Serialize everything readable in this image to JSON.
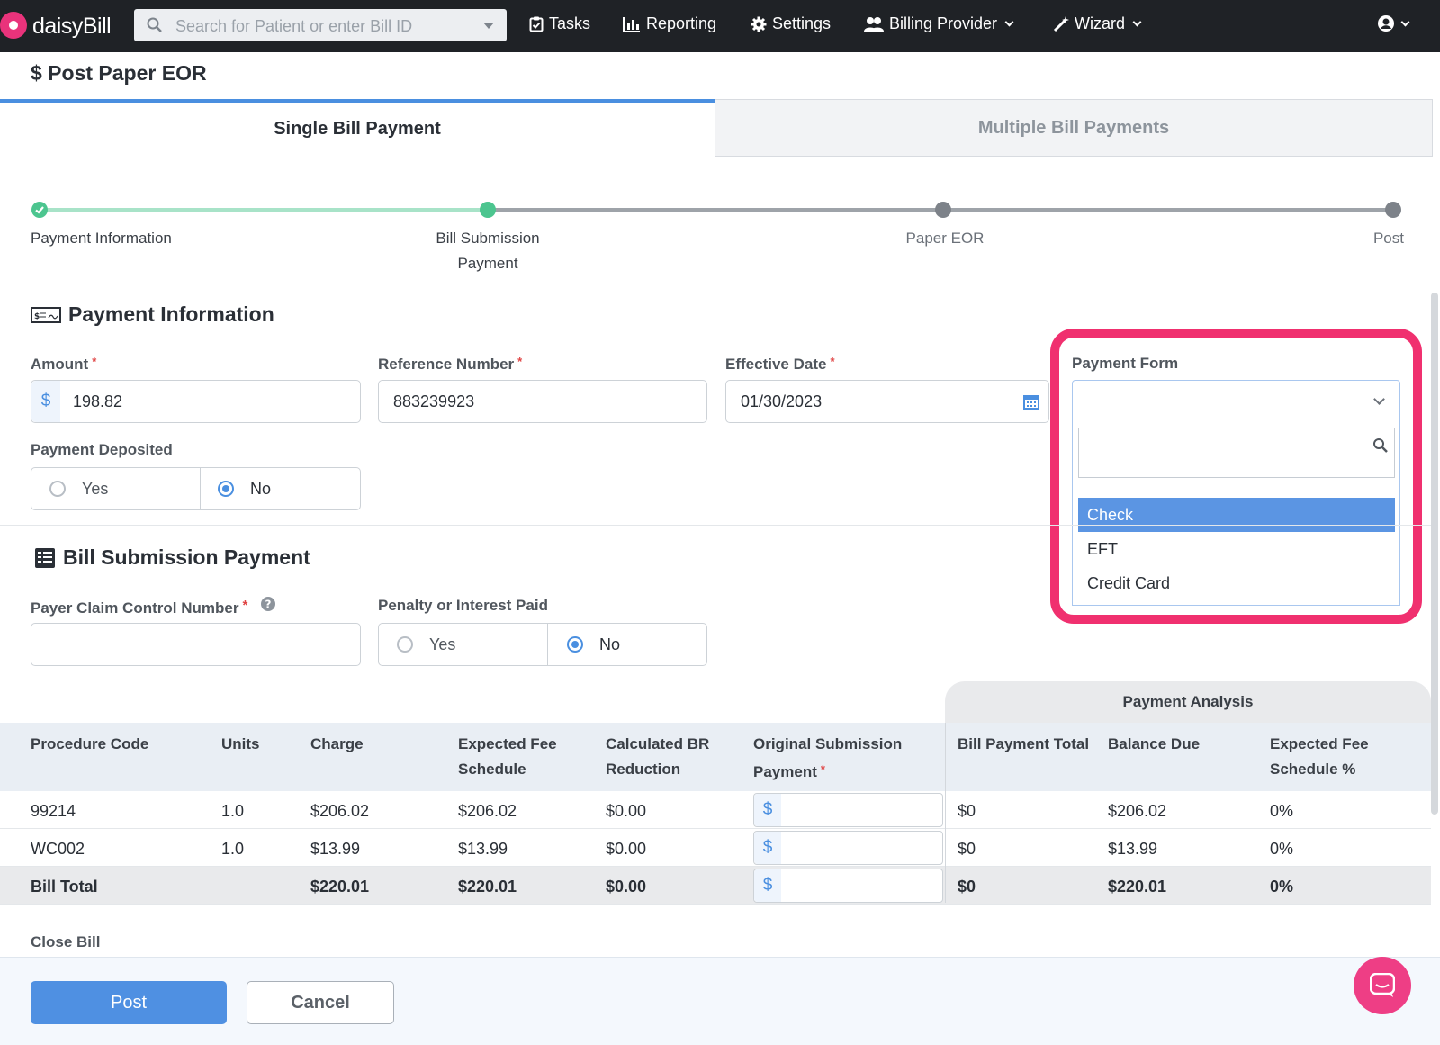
{
  "nav": {
    "brand": "daisyBill",
    "search_placeholder": "Search for Patient or enter Bill ID",
    "tasks": "Tasks",
    "reporting": "Reporting",
    "settings": "Settings",
    "billing_provider": "Billing Provider",
    "wizard": "Wizard"
  },
  "page": {
    "title": "$ Post Paper EOR"
  },
  "tabs": [
    {
      "label": "Single Bill Payment",
      "active": true
    },
    {
      "label": "Multiple Bill Payments",
      "active": false
    }
  ],
  "stepper": {
    "steps": [
      {
        "label": "Payment Information",
        "status": "complete"
      },
      {
        "label": "Bill Submission Payment",
        "status": "current"
      },
      {
        "label": "Paper EOR",
        "status": "upcoming"
      },
      {
        "label": "Post",
        "status": "upcoming"
      }
    ]
  },
  "payment_info": {
    "heading": "Payment Information",
    "amount_label": "Amount",
    "amount_prefix": "$",
    "amount_value": "198.82",
    "reference_label": "Reference Number",
    "reference_value": "883239923",
    "effective_date_label": "Effective Date",
    "effective_date_value": "01/30/2023",
    "payment_form_label": "Payment Form",
    "payment_form_options": [
      "Check",
      "EFT",
      "Credit Card"
    ],
    "payment_form_highlighted": "Check",
    "deposited_label": "Payment Deposited",
    "deposited_yes": "Yes",
    "deposited_no": "No",
    "deposited_selected": "No"
  },
  "bill_submission": {
    "heading": "Bill Submission Payment",
    "pccn_label": "Payer Claim Control Number",
    "penalty_label": "Penalty or Interest Paid",
    "penalty_yes": "Yes",
    "penalty_no": "No",
    "penalty_selected": "No"
  },
  "table": {
    "analysis_header": "Payment Analysis",
    "columns": [
      "Procedure Code",
      "Units",
      "Charge",
      "Expected Fee Schedule",
      "Calculated BR Reduction",
      "Original Submission Payment",
      "Bill Payment Total",
      "Balance Due",
      "Expected Fee Schedule %"
    ],
    "rows": [
      {
        "code": "99214",
        "units": "1.0",
        "charge": "$206.02",
        "efs": "$206.02",
        "br": "$0.00",
        "prefix": "$",
        "bpt": "$0",
        "balance": "$206.02",
        "pct": "0%"
      },
      {
        "code": "WC002",
        "units": "1.0",
        "charge": "$13.99",
        "efs": "$13.99",
        "br": "$0.00",
        "prefix": "$",
        "bpt": "$0",
        "balance": "$13.99",
        "pct": "0%"
      }
    ],
    "total": {
      "code": "Bill Total",
      "units": "",
      "charge": "$220.01",
      "efs": "$220.01",
      "br": "$0.00",
      "prefix": "$",
      "bpt": "$0",
      "balance": "$220.01",
      "pct": "0%"
    }
  },
  "close_bill_label": "Close Bill",
  "buttons": {
    "post": "Post",
    "cancel": "Cancel"
  },
  "colors": {
    "accent": "#4a8fe0",
    "success": "#4cc58f",
    "highlight": "#f0306f",
    "nav_bg": "#1f2226"
  }
}
